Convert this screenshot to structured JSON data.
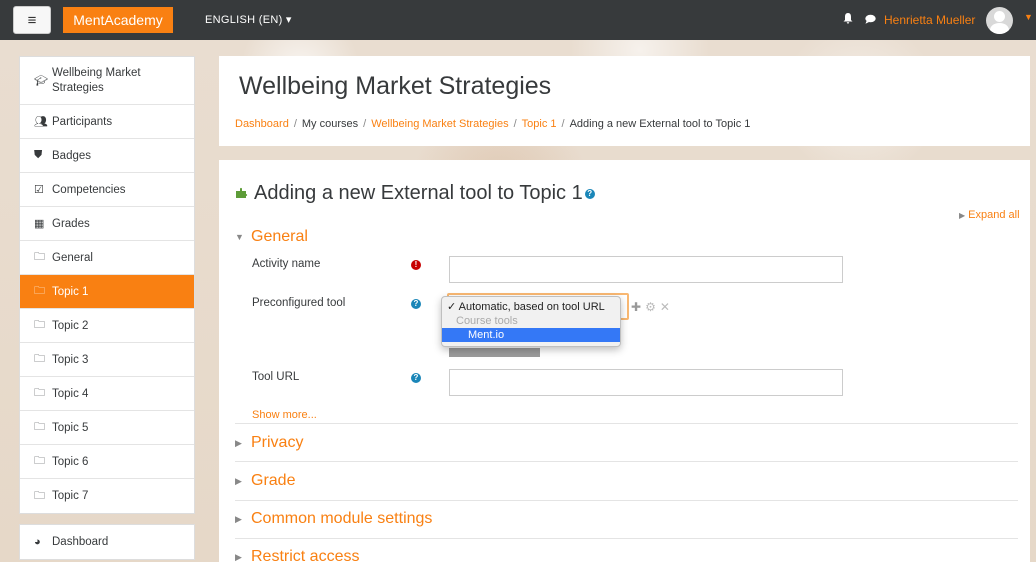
{
  "navbar": {
    "menu_icon": "hamburger-icon",
    "brand": "MentAcademy",
    "language": "ENGLISH (EN) ▾",
    "user_name": "Henrietta Mueller"
  },
  "sidebar": {
    "items": [
      {
        "label": "Wellbeing Market Strategies",
        "icon": "graduation-cap-icon"
      },
      {
        "label": "Participants",
        "icon": "users-icon"
      },
      {
        "label": "Badges",
        "icon": "shield-icon"
      },
      {
        "label": "Competencies",
        "icon": "check-square-icon"
      },
      {
        "label": "Grades",
        "icon": "table-icon"
      },
      {
        "label": "General",
        "icon": "folder-icon"
      },
      {
        "label": "Topic 1",
        "icon": "folder-icon",
        "active": true
      },
      {
        "label": "Topic 2",
        "icon": "folder-icon"
      },
      {
        "label": "Topic 3",
        "icon": "folder-icon"
      },
      {
        "label": "Topic 4",
        "icon": "folder-icon"
      },
      {
        "label": "Topic 5",
        "icon": "folder-icon"
      },
      {
        "label": "Topic 6",
        "icon": "folder-icon"
      },
      {
        "label": "Topic 7",
        "icon": "folder-icon"
      }
    ],
    "dashboard": {
      "label": "Dashboard",
      "icon": "dashboard-icon"
    }
  },
  "header": {
    "title": "Wellbeing Market Strategies",
    "breadcrumb": [
      "Dashboard",
      "My courses",
      "Wellbeing Market Strategies",
      "Topic 1",
      "Adding a new External tool to Topic 1"
    ]
  },
  "form": {
    "title": "Adding a new External tool to Topic 1",
    "expand_all": "Expand all",
    "sections": {
      "general": "General",
      "privacy": "Privacy",
      "grade": "Grade",
      "common": "Common module settings",
      "restrict": "Restrict access"
    },
    "fields": {
      "activity_name_label": "Activity name",
      "activity_name_value": "",
      "preconfigured_label": "Preconfigured tool",
      "tool_url_label": "Tool URL",
      "tool_url_value": ""
    },
    "dropdown": {
      "options": [
        "✓ Automatic, based on tool URL",
        "Course tools",
        "Ment.io"
      ]
    },
    "show_more": "Show more..."
  },
  "colors": {
    "accent": "#f98012",
    "navbar": "#373a3c",
    "highlight": "#3478f6"
  }
}
